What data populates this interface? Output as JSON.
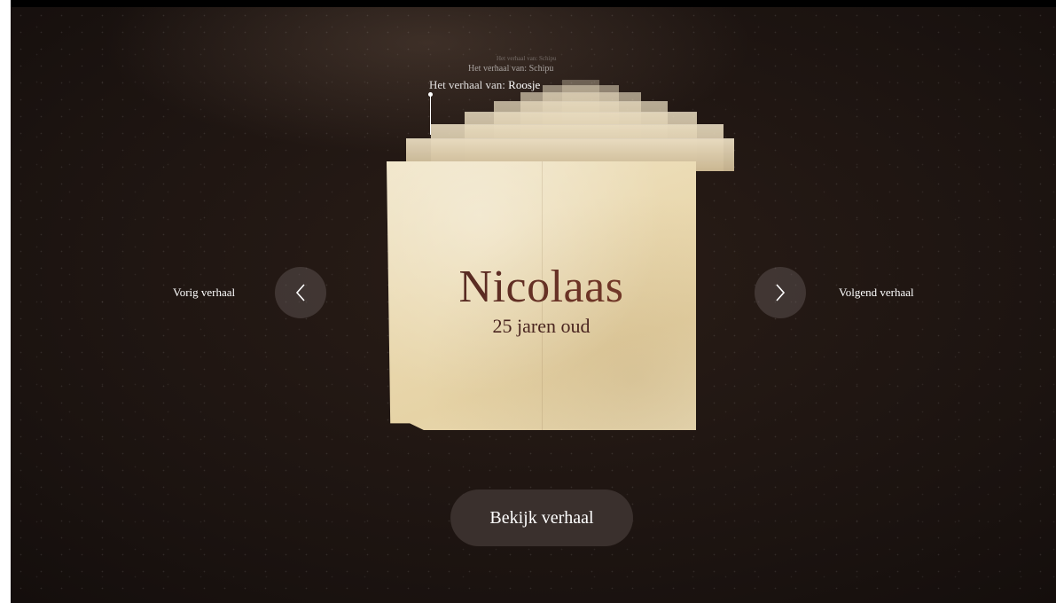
{
  "current_story": {
    "label_prefix": "Het verhaal van:",
    "author": "Roosje",
    "name": "Nicolaas",
    "age": "25 jaren oud"
  },
  "background_stories": [
    {
      "label_prefix": "Het verhaal van:",
      "author": "Schipu"
    },
    {
      "label_prefix": "Het verhaal van:",
      "author": "Schipu"
    }
  ],
  "navigation": {
    "previous_label": "Vorig verhaal",
    "next_label": "Volgend verhaal"
  },
  "actions": {
    "view_story_label": "Bekijk verhaal"
  },
  "icons": {
    "previous": "chevron-left-icon",
    "next": "chevron-right-icon"
  }
}
